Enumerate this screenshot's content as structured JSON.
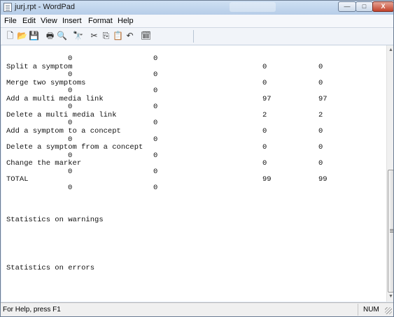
{
  "window": {
    "title": "jurj.rpt - WordPad",
    "controls": {
      "minimize": "—",
      "maximize": "□",
      "close": "X"
    }
  },
  "menu": [
    "File",
    "Edit",
    "View",
    "Insert",
    "Format",
    "Help"
  ],
  "toolbar": {
    "icons": [
      "new-document-icon",
      "open-folder-icon",
      "save-disk-icon",
      "print-icon",
      "print-preview-icon",
      "find-binoculars-icon",
      "cut-scissors-icon",
      "copy-icon",
      "paste-icon",
      "undo-icon",
      "insert-date-time-icon"
    ],
    "glyphs": [
      "🗋",
      "📂",
      "💾",
      "🖶",
      "🔍",
      "🔭",
      "✂",
      "⎘",
      "📋",
      "↶",
      "🗓"
    ]
  },
  "report": {
    "lines": [
      {
        "type": "sub",
        "a": "0",
        "b": "0"
      },
      {
        "type": "row",
        "label": "Split a symptom",
        "v1": "0",
        "v2": "0"
      },
      {
        "type": "sub",
        "a": "0",
        "b": "0"
      },
      {
        "type": "row",
        "label": "Merge two symptoms",
        "v1": "0",
        "v2": "0"
      },
      {
        "type": "sub",
        "a": "0",
        "b": "0"
      },
      {
        "type": "row",
        "label": "Add a multi media link",
        "v1": "97",
        "v2": "97"
      },
      {
        "type": "sub",
        "a": "0",
        "b": "0"
      },
      {
        "type": "row",
        "label": "Delete a multi media link",
        "v1": "2",
        "v2": "2"
      },
      {
        "type": "sub",
        "a": "0",
        "b": "0"
      },
      {
        "type": "row",
        "label": "Add a symptom to a concept",
        "v1": "0",
        "v2": "0"
      },
      {
        "type": "sub",
        "a": "0",
        "b": "0"
      },
      {
        "type": "row",
        "label": "Delete a symptom from a concept",
        "v1": "0",
        "v2": "0"
      },
      {
        "type": "sub",
        "a": "0",
        "b": "0"
      },
      {
        "type": "row",
        "label": "Change the marker",
        "v1": "0",
        "v2": "0"
      },
      {
        "type": "sub",
        "a": "0",
        "b": "0"
      },
      {
        "type": "row",
        "label": "TOTAL",
        "v1": "99",
        "v2": "99"
      },
      {
        "type": "sub",
        "a": "0",
        "b": "0"
      },
      {
        "type": "blank"
      },
      {
        "type": "blank"
      },
      {
        "type": "blank"
      },
      {
        "type": "heading",
        "label": "Statistics on warnings"
      },
      {
        "type": "blank"
      },
      {
        "type": "blank"
      },
      {
        "type": "blank"
      },
      {
        "type": "blank"
      },
      {
        "type": "blank"
      },
      {
        "type": "heading",
        "label": "Statistics on errors"
      }
    ]
  },
  "statusbar": {
    "help": "For Help, press F1",
    "num": "NUM"
  }
}
